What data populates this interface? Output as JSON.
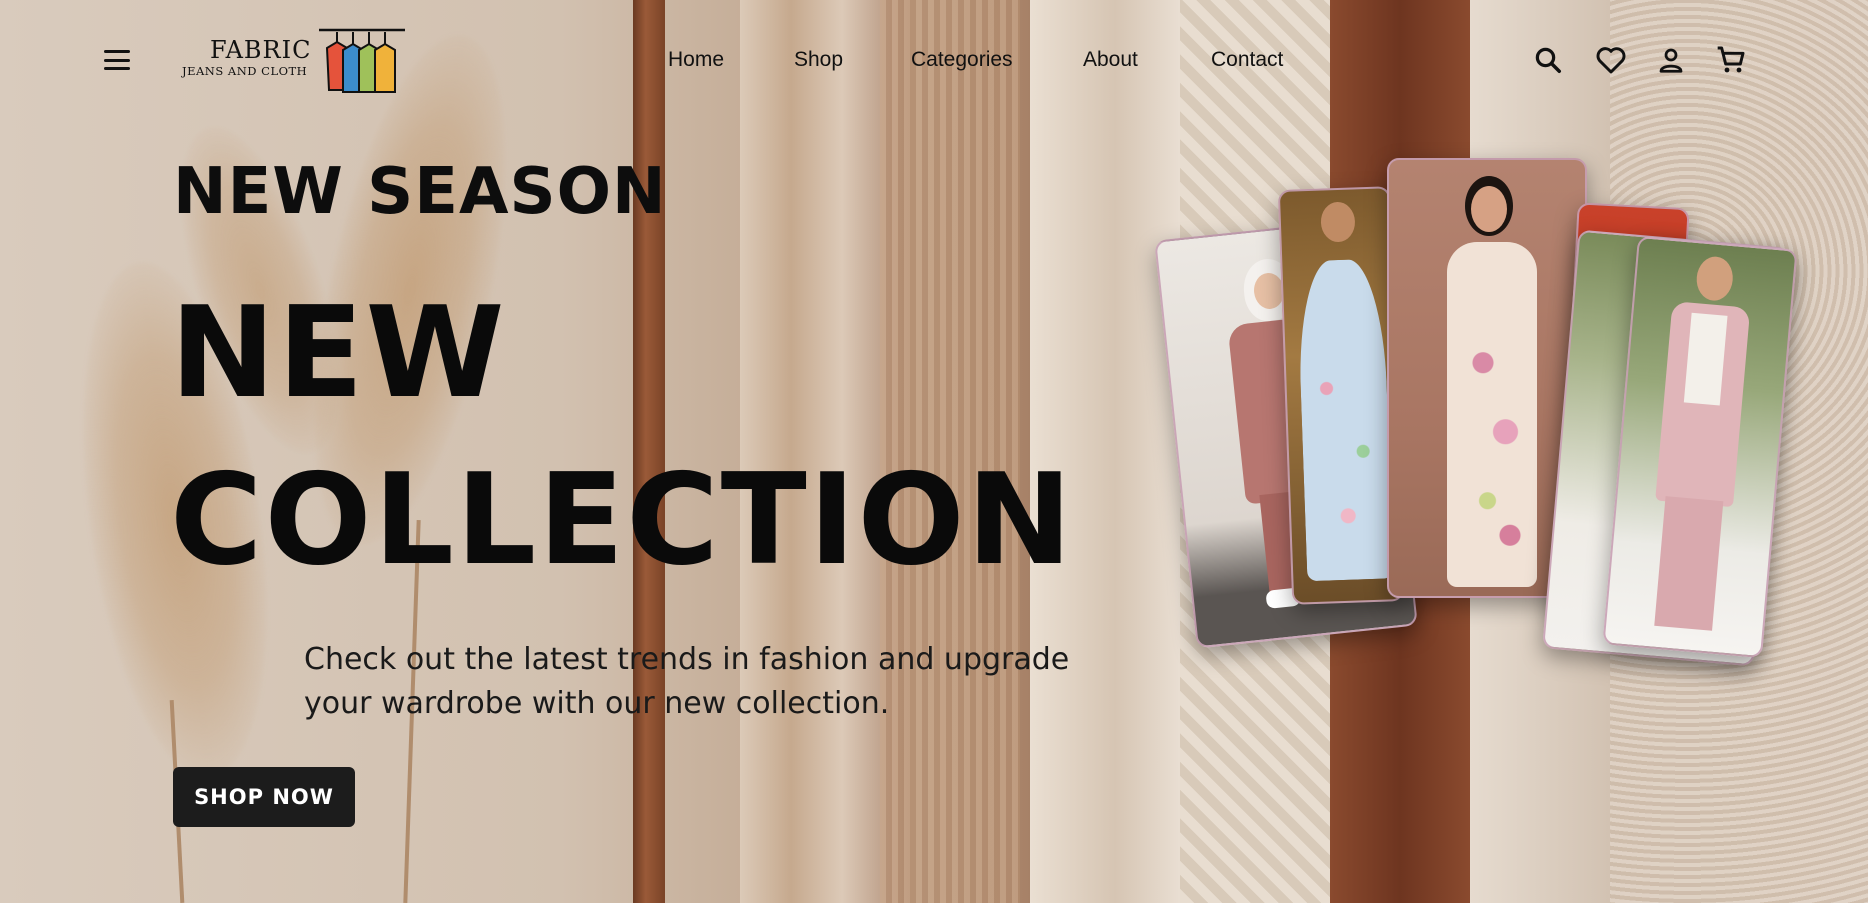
{
  "brand": {
    "name": "FABRIC",
    "tagline": "JEANS AND CLOTH"
  },
  "nav": {
    "items": [
      "Home",
      "Shop",
      "Categories",
      "About",
      "Contact"
    ]
  },
  "icons": {
    "menu": "hamburger-menu-icon",
    "search": "search-icon",
    "wishlist": "heart-icon",
    "account": "user-icon",
    "cart": "shopping-cart-icon"
  },
  "hero": {
    "eyebrow": "NEW SEASON",
    "headline_line1": "NEW",
    "headline_line2": "COLLECTION",
    "description": "Check out the latest trends in fashion and upgrade your wardrobe with our new collection.",
    "cta": "SHOP NOW"
  },
  "colors": {
    "text": "#0a0a0a",
    "button_bg": "#1c1c1c",
    "button_text": "#ffffff",
    "rod": "#8a4a2c"
  }
}
